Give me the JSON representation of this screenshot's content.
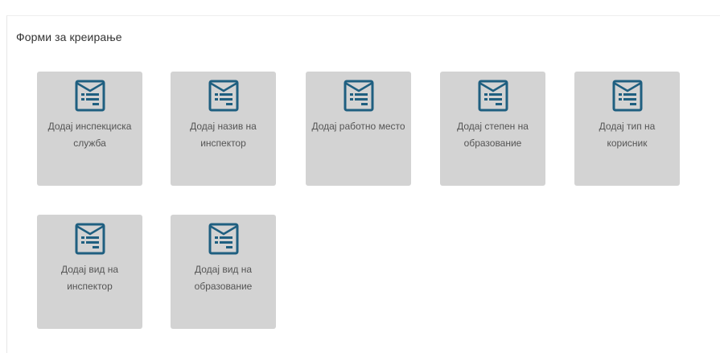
{
  "panel": {
    "title": "Форми за креирање"
  },
  "colors": {
    "tile_bg": "#d3d3d3",
    "icon_stroke": "#1f5f80"
  },
  "tiles": [
    {
      "label": "Додај инспекциска служба",
      "icon": "form-icon"
    },
    {
      "label": "Додај назив на инспектор",
      "icon": "form-icon"
    },
    {
      "label": "Додај работно место",
      "icon": "form-icon"
    },
    {
      "label": "Додај степен на образование",
      "icon": "form-icon"
    },
    {
      "label": "Додај тип на корисник",
      "icon": "form-icon"
    },
    {
      "label": "Додај вид на инспектор",
      "icon": "form-icon"
    },
    {
      "label": "Додај вид на образование",
      "icon": "form-icon"
    }
  ]
}
